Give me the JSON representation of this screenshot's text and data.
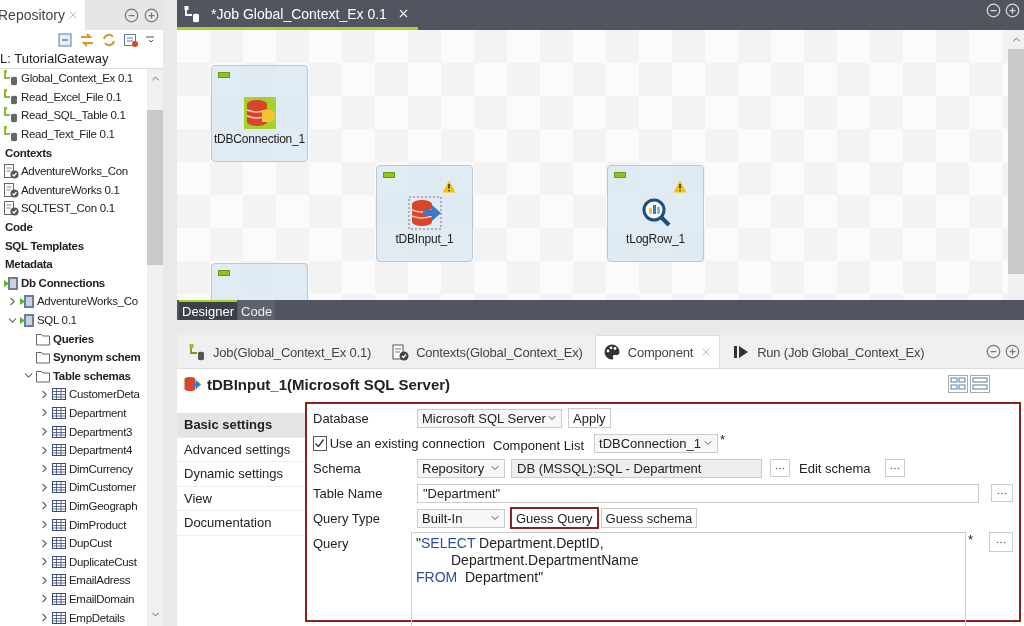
{
  "repository": {
    "title": "Repository",
    "project": "L: TutorialGateway",
    "tree": [
      {
        "kind": "job",
        "label": "Global_Context_Ex 0.1"
      },
      {
        "kind": "job",
        "label": "Read_Excel_File 0.1"
      },
      {
        "kind": "job",
        "label": "Read_SQL_Table 0.1"
      },
      {
        "kind": "job",
        "label": "Read_Text_File 0.1"
      },
      {
        "kind": "category",
        "label": "Contexts",
        "children": [
          {
            "kind": "context",
            "label": "AdventureWorks_Con"
          },
          {
            "kind": "context",
            "label": "AdventureWorks 0.1"
          },
          {
            "kind": "context",
            "label": "SQLTEST_Con 0.1"
          }
        ]
      },
      {
        "kind": "category",
        "label": "Code"
      },
      {
        "kind": "category",
        "label": "SQL Templates"
      },
      {
        "kind": "category",
        "label": "Metadata",
        "children": [
          {
            "kind": "db-group",
            "label": "Db Connections",
            "children": [
              {
                "kind": "connection",
                "label": "AdventureWorks_Co",
                "expanded": false
              },
              {
                "kind": "connection",
                "label": "SQL 0.1",
                "expanded": true,
                "children": [
                  {
                    "kind": "folder",
                    "label": "Queries"
                  },
                  {
                    "kind": "folder",
                    "label": "Synonym schem"
                  },
                  {
                    "kind": "folder",
                    "label": "Table schemas",
                    "expanded": true,
                    "children": [
                      {
                        "kind": "table",
                        "label": "CustomerDeta",
                        "expanded": false
                      },
                      {
                        "kind": "table",
                        "label": "Department",
                        "expanded": false
                      },
                      {
                        "kind": "table",
                        "label": "Department3",
                        "expanded": false
                      },
                      {
                        "kind": "table",
                        "label": "Department4",
                        "expanded": false
                      },
                      {
                        "kind": "table",
                        "label": "DimCurrency",
                        "expanded": false
                      },
                      {
                        "kind": "table",
                        "label": "DimCustomer",
                        "expanded": false
                      },
                      {
                        "kind": "table",
                        "label": "DimGeograph",
                        "expanded": false
                      },
                      {
                        "kind": "table",
                        "label": "DimProduct",
                        "expanded": false
                      },
                      {
                        "kind": "table",
                        "label": "DupCust",
                        "expanded": false
                      },
                      {
                        "kind": "table",
                        "label": "DuplicateCust",
                        "expanded": false
                      },
                      {
                        "kind": "table",
                        "label": "EmailAdress",
                        "expanded": false
                      },
                      {
                        "kind": "table",
                        "label": "EmailDomain",
                        "expanded": false
                      },
                      {
                        "kind": "table",
                        "label": "EmpDetails",
                        "expanded": false
                      }
                    ]
                  }
                ]
              }
            ]
          }
        ]
      }
    ]
  },
  "editor": {
    "tabs": [
      {
        "label": "*Job Global_Context_Ex 0.1",
        "selected": true
      }
    ],
    "nodes": [
      {
        "kind": "db-connection",
        "label": "tDBConnection_1",
        "warning": false
      },
      {
        "kind": "db-input",
        "label": "tDBInput_1",
        "warning": true
      },
      {
        "kind": "log-row",
        "label": "tLogRow_1",
        "warning": true
      },
      {
        "kind": "hidden",
        "warning": false
      }
    ],
    "bottom_tabs": [
      {
        "label": "Designer",
        "selected": true
      },
      {
        "label": "Code",
        "selected": false
      }
    ]
  },
  "view_tabs": [
    {
      "kind": "job",
      "label": "Job(Global_Context_Ex 0.1)",
      "selected": false
    },
    {
      "kind": "contexts",
      "label": "Contexts(Global_Context_Ex)",
      "selected": false
    },
    {
      "kind": "component",
      "label": "Component",
      "selected": true
    },
    {
      "kind": "run",
      "label": "Run (Job Global_Context_Ex)",
      "selected": false
    }
  ],
  "component_title": "tDBInput_1(Microsoft SQL Server)",
  "settings_tabs": [
    {
      "label": "Basic settings",
      "selected": true
    },
    {
      "label": "Advanced settings",
      "selected": false
    },
    {
      "label": "Dynamic settings",
      "selected": false
    },
    {
      "label": "View",
      "selected": false
    },
    {
      "label": "Documentation",
      "selected": false
    }
  ],
  "form": {
    "database": {
      "label": "Database",
      "value": "Microsoft SQL Server",
      "button": "Apply"
    },
    "use_existing": {
      "label": "Use an existing connection",
      "checked": true
    },
    "component_list": {
      "label": "Component List",
      "value": "tDBConnection_1",
      "required": "*"
    },
    "schema": {
      "label": "Schema",
      "value": "Repository",
      "path": "DB (MSSQL):SQL - Department",
      "edit_label": "Edit schema"
    },
    "table_name": {
      "label": "Table Name",
      "value": "\"Department\""
    },
    "query_type": {
      "label": "Query Type",
      "value": "Built-In",
      "buttons": [
        {
          "label": "Guess Query",
          "highlighted": true
        },
        {
          "label": "Guess schema",
          "highlighted": false
        }
      ]
    },
    "query": {
      "label": "Query",
      "required": "*",
      "lines": [
        {
          "indent": false,
          "parts": [
            {
              "kind": "plain",
              "text": "\""
            },
            {
              "kind": "keyword",
              "text": "SELECT"
            },
            {
              "kind": "plain",
              "text": " Department.DeptID,"
            }
          ]
        },
        {
          "indent": true,
          "parts": [
            {
              "kind": "plain",
              "text": "Department.DepartmentName"
            }
          ]
        },
        {
          "indent": false,
          "parts": [
            {
              "kind": "keyword",
              "text": "FROM"
            },
            {
              "kind": "plain",
              "text": "  Department\""
            }
          ]
        }
      ]
    }
  }
}
